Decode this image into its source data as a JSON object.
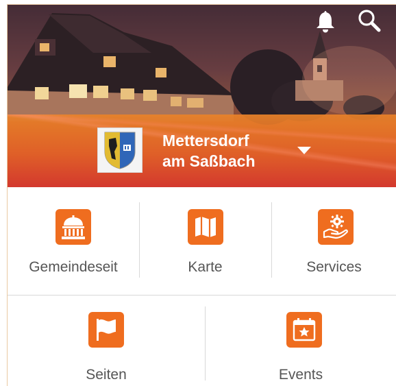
{
  "header": {
    "bell_icon": "bell-icon",
    "search_icon": "search-icon",
    "crest_icon": "coat-of-arms",
    "location_line1": "Mettersdorf",
    "location_line2": "am Saßbach",
    "dropdown_icon": "caret-down-icon"
  },
  "tiles": [
    {
      "label": "Gemeindeseit",
      "icon": "townhall-icon"
    },
    {
      "label": "Karte",
      "icon": "map-icon"
    },
    {
      "label": "Services",
      "icon": "services-icon"
    },
    {
      "label": "Seiten",
      "icon": "flag-icon"
    },
    {
      "label": "Events",
      "icon": "calendar-star-icon"
    }
  ],
  "colors": {
    "accent": "#ef6d1f",
    "label_text": "#555555",
    "divider": "#d8d8d8"
  }
}
